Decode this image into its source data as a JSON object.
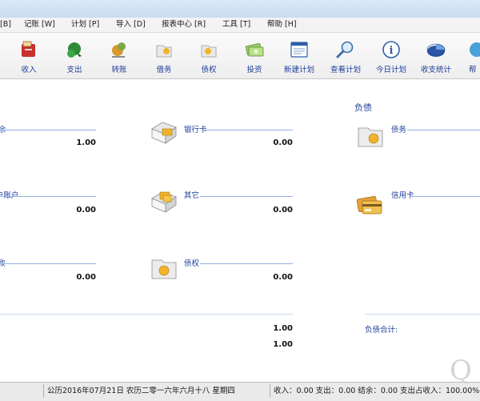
{
  "menu": [
    "[B]",
    "记账 [W]",
    "计划 [P]",
    "导入 [D]",
    "报表中心 [R]",
    "工具 [T]",
    "帮助 [H]"
  ],
  "toolbar": [
    {
      "label": "收入",
      "icon": "income-icon"
    },
    {
      "label": "支出",
      "icon": "expense-icon"
    },
    {
      "label": "转账",
      "icon": "transfer-icon"
    },
    {
      "label": "借务",
      "icon": "debt-icon"
    },
    {
      "label": "债权",
      "icon": "claim-icon"
    },
    {
      "label": "投资",
      "icon": "investment-icon"
    },
    {
      "label": "新建计划",
      "icon": "new-plan-icon"
    },
    {
      "label": "查看计划",
      "icon": "view-plan-icon"
    },
    {
      "label": "今日计划",
      "icon": "today-plan-icon"
    },
    {
      "label": "收支统计",
      "icon": "statistics-icon"
    },
    {
      "label": "帮",
      "icon": "help-icon"
    }
  ],
  "main": {
    "liabilities_title": "负债",
    "assets": {
      "col1": [
        {
          "label": "余",
          "amount": "1.00"
        },
        {
          "label": "户账户",
          "amount": "0.00"
        },
        {
          "label": "款",
          "amount": "0.00"
        }
      ],
      "col2": [
        {
          "label": "银行卡",
          "amount": "0.00",
          "icon": "bank-card-icon"
        },
        {
          "label": "其它",
          "amount": "0.00",
          "icon": "other-icon"
        },
        {
          "label": "债权",
          "amount": "0.00",
          "icon": "claim-folder-icon"
        }
      ]
    },
    "liabilities": [
      {
        "label": "债务",
        "icon": "debt-folder-icon"
      },
      {
        "label": "信用卡",
        "icon": "credit-card-icon"
      }
    ],
    "asset_total": "1.00",
    "net_total": "1.00",
    "liability_total_label": "负债合计:"
  },
  "statusbar": {
    "date": "公历2016年07月21日 农历二零一六年六月十八 星期四",
    "summary": "收入：0.00 支出：0.00 结余：0.00 支出占收入：100.00%"
  },
  "colors": {
    "label_blue": "#1f3e9a",
    "underline": "#8fb3e0",
    "toolbar_bg": "#eeeeee"
  }
}
